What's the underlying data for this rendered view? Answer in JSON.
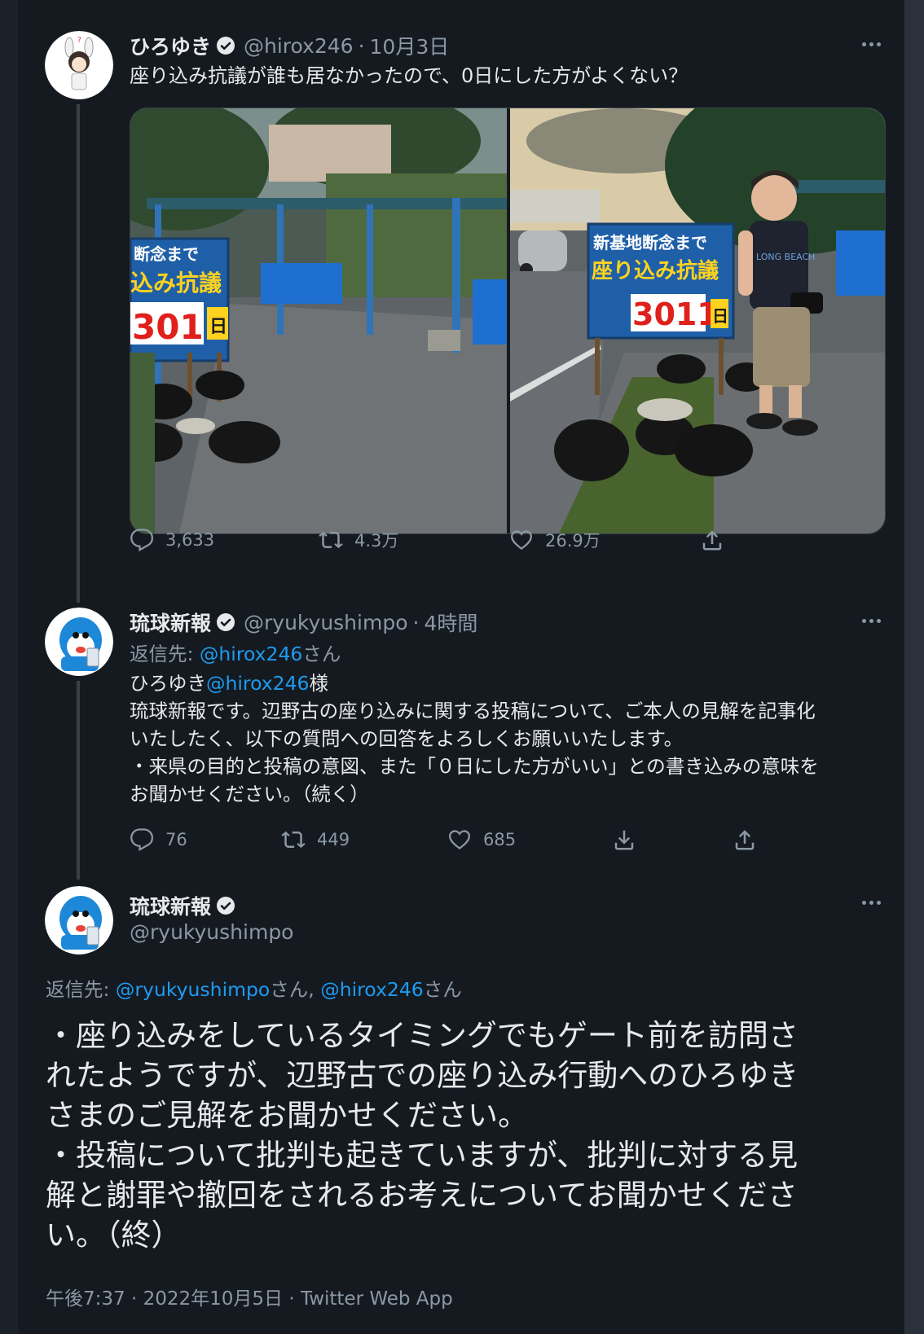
{
  "tweet1": {
    "name": "ひろゆき",
    "handle": "@hirox246",
    "sep": "·",
    "date": "10月3日",
    "text": "座り込み抗議が誰も居なかったので、0日にした方がよくない？",
    "photo_left_sign": {
      "line1": "断念まで",
      "line2": "込み抗議",
      "number": "3011",
      "unit": "日"
    },
    "photo_right_sign": {
      "line1": "新基地断念まで",
      "line2": "座り込み抗議",
      "number": "3011",
      "unit": "日",
      "shirt": "LONG BEACH"
    },
    "replies": "3,633",
    "retweets": "4.3万",
    "likes": "26.9万"
  },
  "tweet2": {
    "name": "琉球新報",
    "handle": "@ryukyushimpo",
    "sep": "·",
    "date": "4時間",
    "reply_prefix": "返信先: ",
    "reply_to": "@hirox246",
    "reply_suffix": "さん",
    "line1_name": "ひろゆき",
    "line1_handle": "@hirox246",
    "line1_suffix": "様",
    "body": "琉球新報です。辺野古の座り込みに関する投稿について、ご本人の見解を記事化\nいたしたく、以下の質問への回答をよろしくお願いいたします。\n・来県の目的と投稿の意図、また「０日にした方がいい」との書き込みの意味を\nお聞かせください。（続く）",
    "replies": "76",
    "retweets": "449",
    "likes": "685"
  },
  "tweet3": {
    "name": "琉球新報",
    "handle": "@ryukyushimpo",
    "reply_prefix": "返信先: ",
    "reply_to1": "@ryukyushimpo",
    "reply_mid": "さん, ",
    "reply_to2": "@hirox246",
    "reply_suffix": "さん",
    "body": "・座り込みをしているタイミングでもゲート前を訪問さ\nれたようですが、辺野古での座り込み行動へのひろゆき\nさまのご見解をお聞かせください。\n・投稿について批判も起きていますが、批判に対する見\n解と謝罪や撤回をされるお考えについてお聞かせくださ\nい。（終）",
    "timestamp": "午後7:37 · 2022年10月5日 · Twitter Web App"
  },
  "colors": {
    "background": "#151a21",
    "text": "#e7e9ea",
    "muted": "#8b98a5",
    "link": "#1d9bf0",
    "verified": "#ffffff"
  }
}
